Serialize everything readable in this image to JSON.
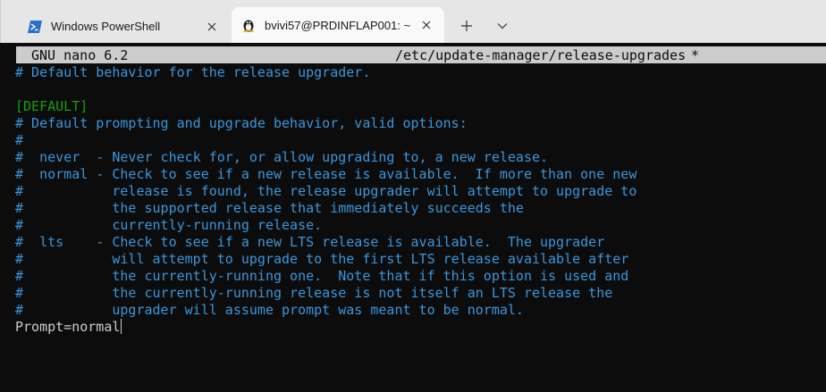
{
  "tabs": [
    {
      "title": "Windows PowerShell",
      "icon": "powershell-icon"
    },
    {
      "title": "bvivi57@PRDINFLAP001: ~",
      "icon": "linux-penguin-icon"
    }
  ],
  "nano": {
    "version": "GNU nano 6.2",
    "file": "/etc/update-manager/release-upgrades",
    "modified": "*"
  },
  "lines": [
    "# Default behavior for the release upgrader.",
    "",
    "[DEFAULT]",
    "# Default prompting and upgrade behavior, valid options:",
    "#",
    "#  never  - Never check for, or allow upgrading to, a new release.",
    "#  normal - Check to see if a new release is available.  If more than one new",
    "#           release is found, the release upgrader will attempt to upgrade to",
    "#           the supported release that immediately succeeds the",
    "#           currently-running release.",
    "#  lts    - Check to see if a new LTS release is available.  The upgrader",
    "#           will attempt to upgrade to the first LTS release available after",
    "#           the currently-running one.  Note that if this option is used and",
    "#           the currently-running release is not itself an LTS release the",
    "#           upgrader will assume prompt was meant to be normal.",
    "Prompt=normal"
  ],
  "colors": {
    "comment": "#3a96dd",
    "section": "#13a10e",
    "text": "#cccccc",
    "background": "#0c0c0c"
  }
}
